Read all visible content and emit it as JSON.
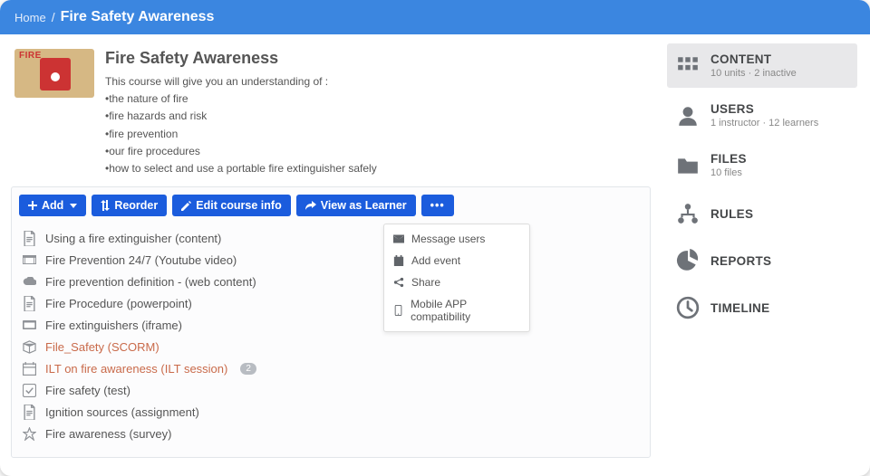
{
  "breadcrumb": {
    "home": "Home",
    "current": "Fire Safety Awareness"
  },
  "course": {
    "title": "Fire Safety Awareness",
    "thumb_caption": "FIRE",
    "intro": "This course will give you an understanding of :",
    "bullets": [
      "•the nature of fire",
      "•fire hazards and risk",
      "•fire prevention",
      "•our fire procedures",
      "•how to select and use a portable fire extinguisher safely"
    ]
  },
  "toolbar": {
    "add": "Add",
    "reorder": "Reorder",
    "edit": "Edit course info",
    "view": "View as Learner",
    "more": "⋯"
  },
  "more_menu": {
    "message": "Message users",
    "event": "Add event",
    "share": "Share",
    "mobile": "Mobile APP compatibility"
  },
  "content": [
    {
      "icon": "doc",
      "title": "Using a fire extinguisher (content)"
    },
    {
      "icon": "video",
      "title": "Fire Prevention 24/7 (Youtube video)"
    },
    {
      "icon": "cloud",
      "title": "Fire prevention definition - (web content)"
    },
    {
      "icon": "doc",
      "title": "Fire Procedure (powerpoint)"
    },
    {
      "icon": "iframe",
      "title": "Fire extinguishers (iframe)"
    },
    {
      "icon": "package",
      "title": "File_Safety (SCORM)",
      "warn": true
    },
    {
      "icon": "calendar",
      "title": "ILT on fire awareness (ILT session)",
      "warn": true,
      "badge": "2"
    },
    {
      "icon": "check",
      "title": "Fire safety (test)"
    },
    {
      "icon": "doc",
      "title": "Ignition sources (assignment)"
    },
    {
      "icon": "star",
      "title": "Fire awareness (survey)"
    }
  ],
  "sidebar": {
    "content": {
      "label": "CONTENT",
      "sub": "10 units · 2 inactive"
    },
    "users": {
      "label": "USERS",
      "sub": "1 instructor · 12 learners"
    },
    "files": {
      "label": "FILES",
      "sub": "10 files"
    },
    "rules": {
      "label": "RULES"
    },
    "reports": {
      "label": "REPORTS"
    },
    "timeline": {
      "label": "TIMELINE"
    }
  }
}
